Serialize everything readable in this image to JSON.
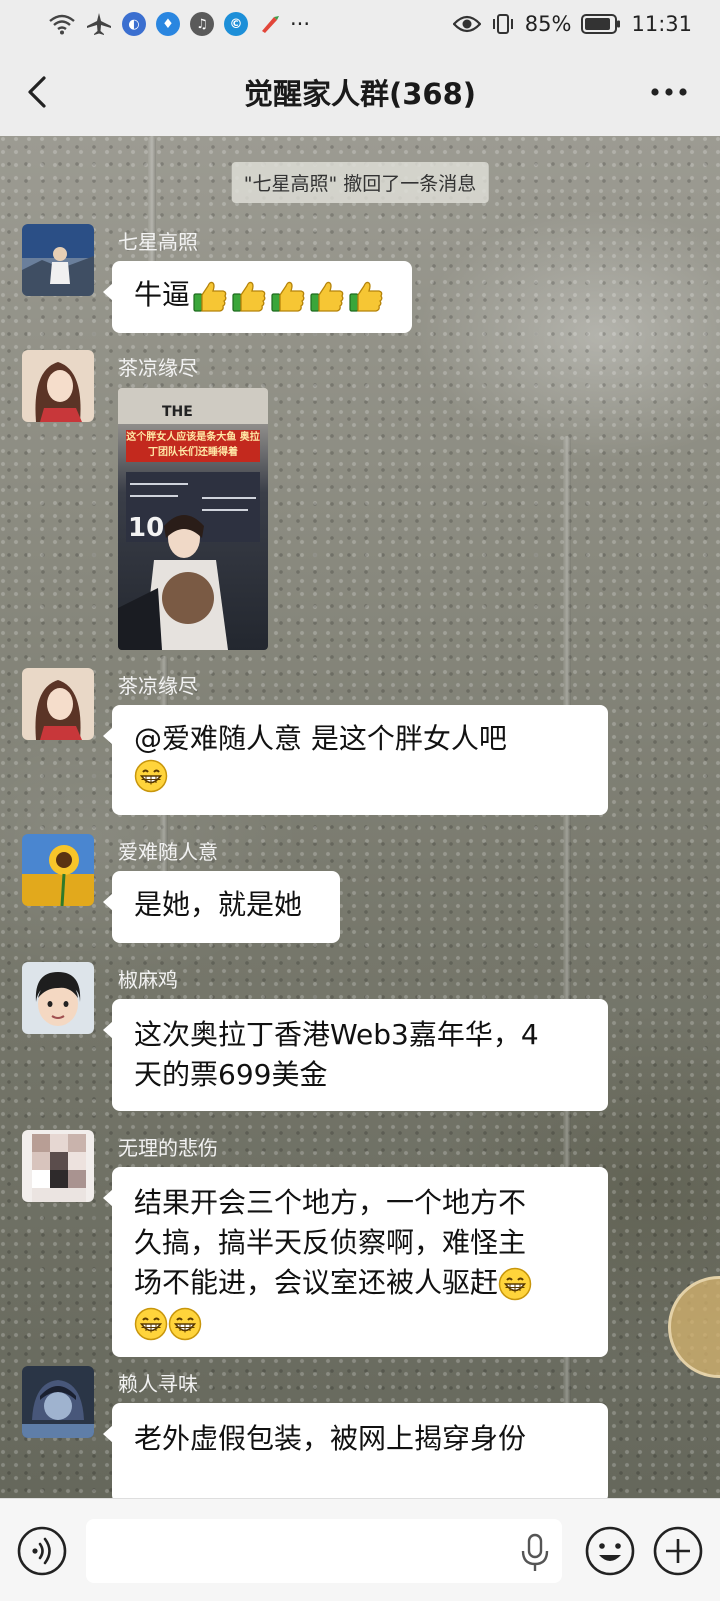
{
  "status_bar": {
    "battery": "85%",
    "time": "11:31",
    "dots": "···",
    "icons": [
      "wifi-icon",
      "airplane-mode-icon",
      "app-icon-1",
      "app-icon-2",
      "app-icon-3",
      "app-icon-4",
      "app-icon-5",
      "eye-comfort-icon",
      "vibrate-icon",
      "battery-icon"
    ]
  },
  "header": {
    "title": "觉醒家人群(368)",
    "back_icon": "chevron-left-icon",
    "more_icon": "more-dots-icon"
  },
  "system_message": "\"七星高照\" 撤回了一条消息",
  "messages": [
    {
      "sender": "七星高照",
      "text": "牛逼",
      "emoji": "thumbs-up x5"
    },
    {
      "sender": "茶凉缘尽",
      "image_caption": "这个胖女人应该是条大鱼 奥拉丁团队长们还睡得着"
    },
    {
      "sender": "茶凉缘尽",
      "text": "@爱难随人意  是这个胖女人吧",
      "emoji": "grin"
    },
    {
      "sender": "爱难随人意",
      "text": "是她，就是她"
    },
    {
      "sender": "椒麻鸡",
      "line1": "这次奥拉丁香港Web3嘉年华，4",
      "line2": "天的票699美金"
    },
    {
      "sender": "无理的悲伤",
      "line1": "结果开会三个地方，一个地方不",
      "line2": "久搞，搞半天反侦察啊，难怪主",
      "line3": "场不能进，会议室还被人驱赶"
    },
    {
      "sender": "赖人寻味",
      "text": "老外虚假包装，被网上揭穿身份"
    }
  ],
  "input_bar": {
    "voice_icon": "voice-input-icon",
    "mic_icon": "microphone-icon",
    "emoji_icon": "emoji-icon",
    "plus_icon": "plus-icon"
  },
  "colors": {
    "bar_bg": "#ededed",
    "bubble": "#ffffff",
    "sender_text": "#f2f2f2"
  }
}
